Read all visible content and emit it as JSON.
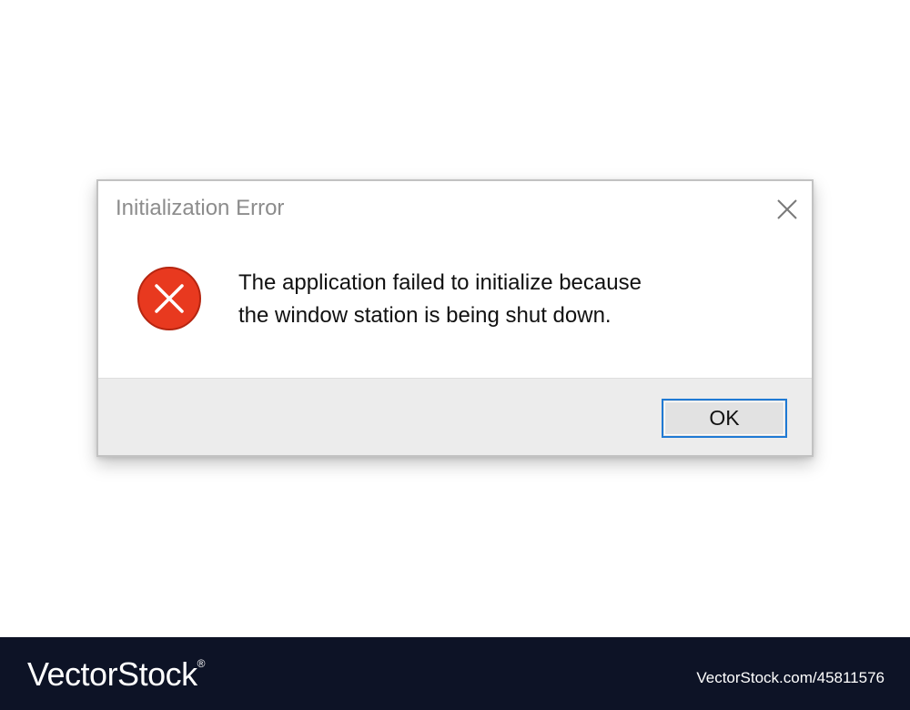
{
  "dialog": {
    "title": "Initialization Error",
    "message_lines": [
      "The application failed to initialize because",
      "the window station is being shut down."
    ],
    "ok_label": "OK",
    "icons": {
      "close": "close-icon",
      "error": "error-icon"
    },
    "colors": {
      "error_red": "#e8391f",
      "button_focus_border": "#1f7ad4",
      "footer_bg": "#ececec",
      "title_text": "#8c8c8c"
    }
  },
  "watermark": {
    "logo": "VectorStock",
    "registered": "®",
    "id": "VectorStock.com/45811576"
  }
}
